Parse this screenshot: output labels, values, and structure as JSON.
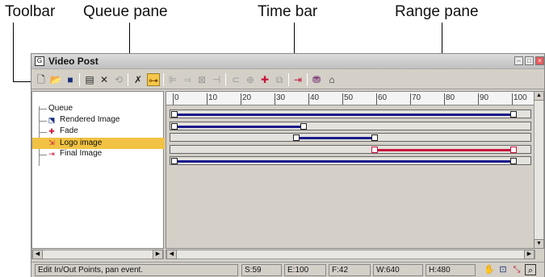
{
  "callouts": {
    "toolbar": "Toolbar",
    "queue_pane": "Queue pane",
    "time_bar": "Time bar",
    "range_pane": "Range pane"
  },
  "window": {
    "title": "Video Post"
  },
  "queue": {
    "items": [
      {
        "label": "Queue"
      },
      {
        "label": "Rendered Image"
      },
      {
        "label": "Fade"
      },
      {
        "label": "Logo image"
      },
      {
        "label": "Final Image"
      }
    ],
    "selected": "Logo image"
  },
  "ruler": {
    "ticks": [
      "0",
      "10",
      "20",
      "30",
      "40",
      "50",
      "60",
      "70",
      "80",
      "90",
      "100"
    ]
  },
  "ranges": [
    {
      "name": "Queue",
      "start": 0,
      "end": 100,
      "color": "#1a1a8c"
    },
    {
      "name": "Rendered Image",
      "start": 0,
      "end": 38,
      "color": "#1a1a8c"
    },
    {
      "name": "Fade",
      "start": 36,
      "end": 59,
      "color": "#1a1a8c"
    },
    {
      "name": "Logo image",
      "start": 59,
      "end": 100,
      "color": "#c8153c"
    },
    {
      "name": "Final Image",
      "start": 0,
      "end": 100,
      "color": "#1a1a8c"
    }
  ],
  "status": {
    "message": "Edit In/Out Points, pan event.",
    "s": "S:59",
    "e": "E:100",
    "f": "F:42",
    "w": "W:640",
    "h": "H:480"
  }
}
